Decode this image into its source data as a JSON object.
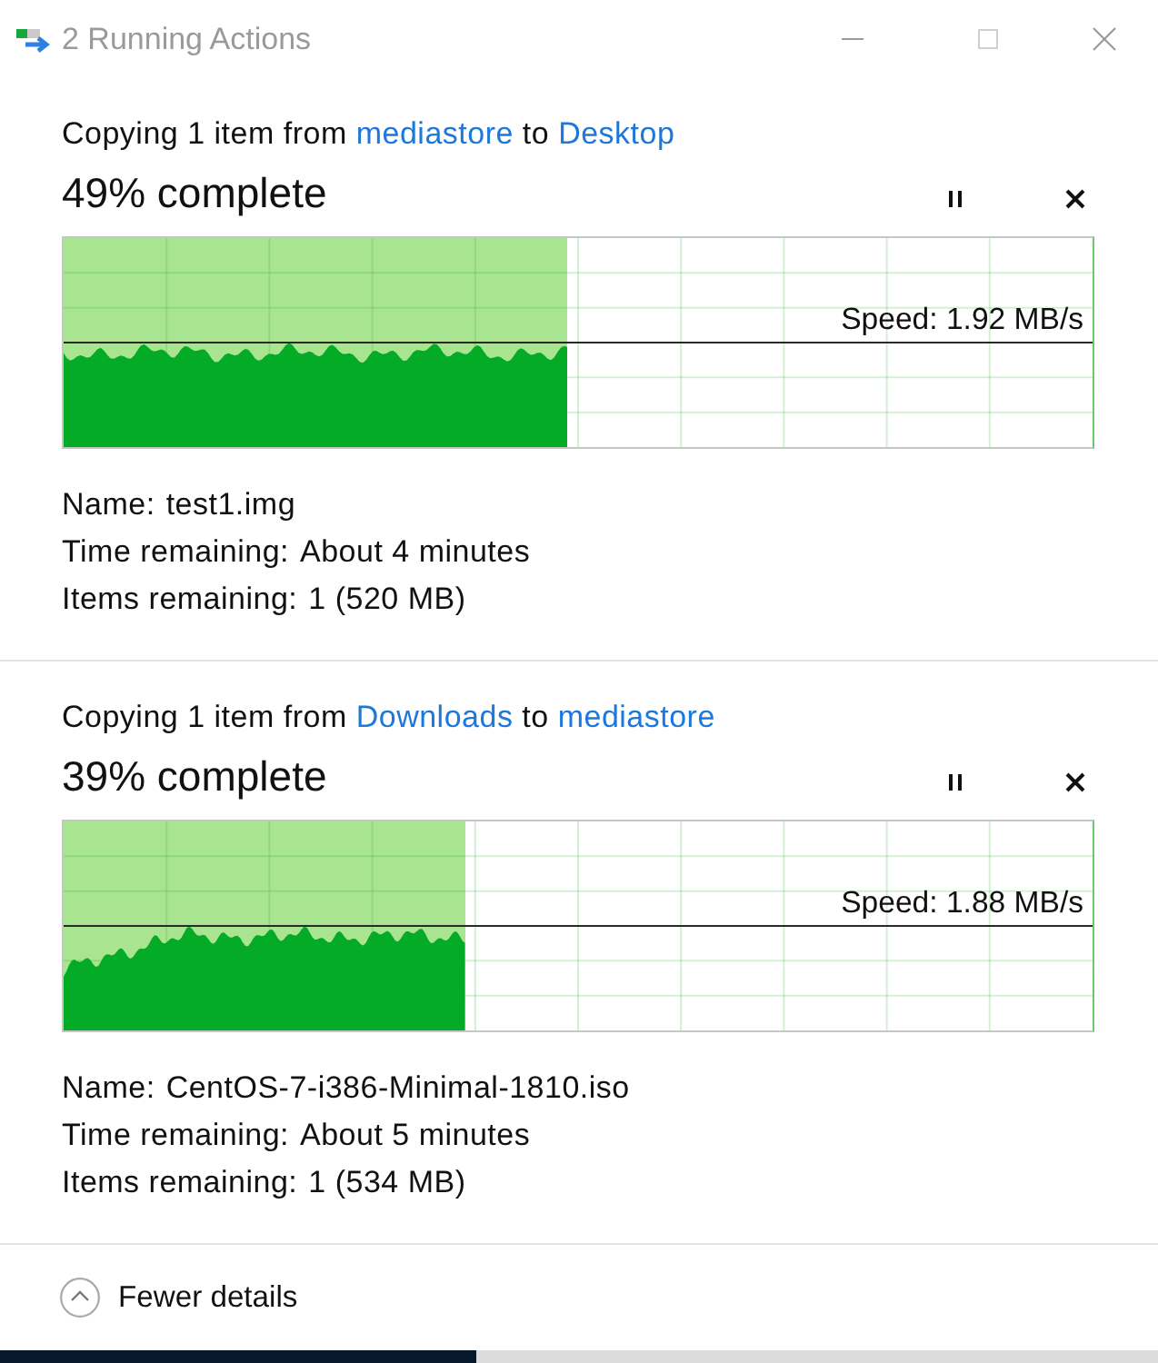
{
  "window": {
    "title": "2 Running Actions"
  },
  "operations": [
    {
      "description": {
        "prefix": "Copying 1 item from",
        "source": "mediastore",
        "middle": "to",
        "destination": "Desktop"
      },
      "progress_text": "49% complete",
      "level": 0.49,
      "speed": "Speed: 1.92 MB/s",
      "details": [
        {
          "label": "Name:",
          "value": "test1.img"
        },
        {
          "label": "Time remaining:",
          "value": "About 4 minutes"
        },
        {
          "label": "Items remaining:",
          "value": "1 (520 MB)"
        }
      ]
    },
    {
      "description": {
        "prefix": "Copying 1 item from",
        "source": "Downloads",
        "middle": "to",
        "destination": "mediastore"
      },
      "progress_text": "39% complete",
      "level": 0.39,
      "speed": "Speed: 1.88 MB/s",
      "details": [
        {
          "label": "Name:",
          "value": "CentOS-7-i386-Minimal-1810.iso"
        },
        {
          "label": "Time remaining:",
          "value": "About 5 minutes"
        },
        {
          "label": "Items remaining:",
          "value": "1 (534 MB)"
        }
      ]
    }
  ],
  "footer": {
    "toggle": "Fewer details",
    "expanded": true
  }
}
